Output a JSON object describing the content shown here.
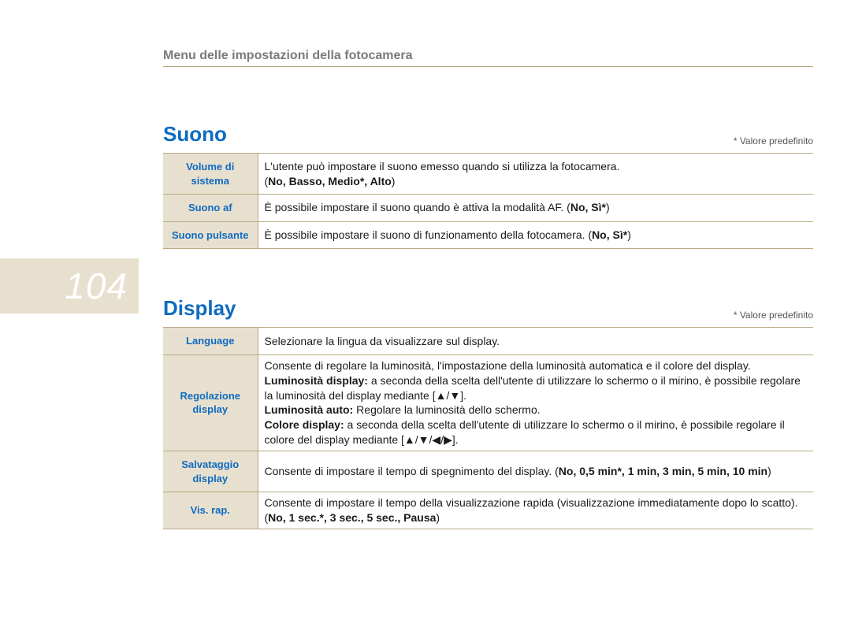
{
  "page_number": "104",
  "breadcrumb": "Menu delle impostazioni della fotocamera",
  "default_note": "* Valore predefinito",
  "section_sound": {
    "title": "Suono",
    "rows": [
      {
        "label": "Volume di sistema",
        "desc_plain1": "L'utente può impostare il suono emesso quando si utilizza la fotocamera.",
        "desc_plain2": "(",
        "desc_bold": "No, Basso, Medio*, Alto",
        "desc_plain3": ")"
      },
      {
        "label": "Suono af",
        "desc_plain1": "È possibile impostare il suono quando è attiva la modalità AF. (",
        "desc_bold": "No, Sì*",
        "desc_plain2": ")"
      },
      {
        "label": "Suono pulsante",
        "desc_plain1": "È possibile impostare il suono di funzionamento della fotocamera. (",
        "desc_bold": "No, Sì*",
        "desc_plain2": ")"
      }
    ]
  },
  "section_display": {
    "title": "Display",
    "rows": {
      "language": {
        "label": "Language",
        "desc": "Selezionare la lingua da visualizzare sul display."
      },
      "regolazione": {
        "label": "Regolazione display",
        "line1": "Consente di regolare la luminosità, l'impostazione della luminosità automatica e il colore del display.",
        "l2_bold": "Luminosità display:",
        "l2_rest": " a seconda della scelta dell'utente di utilizzare lo schermo o il mirino, è possibile regolare la luminosità del display mediante [▲/▼].",
        "l3_bold": "Luminosità auto:",
        "l3_rest": " Regolare la luminosità dello schermo.",
        "l4_bold": "Colore display:",
        "l4_rest": " a seconda della scelta dell'utente di utilizzare lo schermo o il mirino, è possibile regolare il colore del display mediante [▲/▼/◀/▶]."
      },
      "salvataggio": {
        "label": "Salvataggio display",
        "plain1": "Consente di impostare il tempo di spegnimento del display. (",
        "bold": "No, 0,5 min*, 1 min, 3 min, 5 min, 10 min",
        "plain2": ")"
      },
      "visrap": {
        "label": "Vis. rap.",
        "plain1": "Consente di impostare il tempo della visualizzazione rapida (visualizzazione immediatamente dopo lo scatto). (",
        "bold": "No, 1 sec.*, 3 sec., 5 sec., Pausa",
        "plain2": ")"
      }
    }
  }
}
